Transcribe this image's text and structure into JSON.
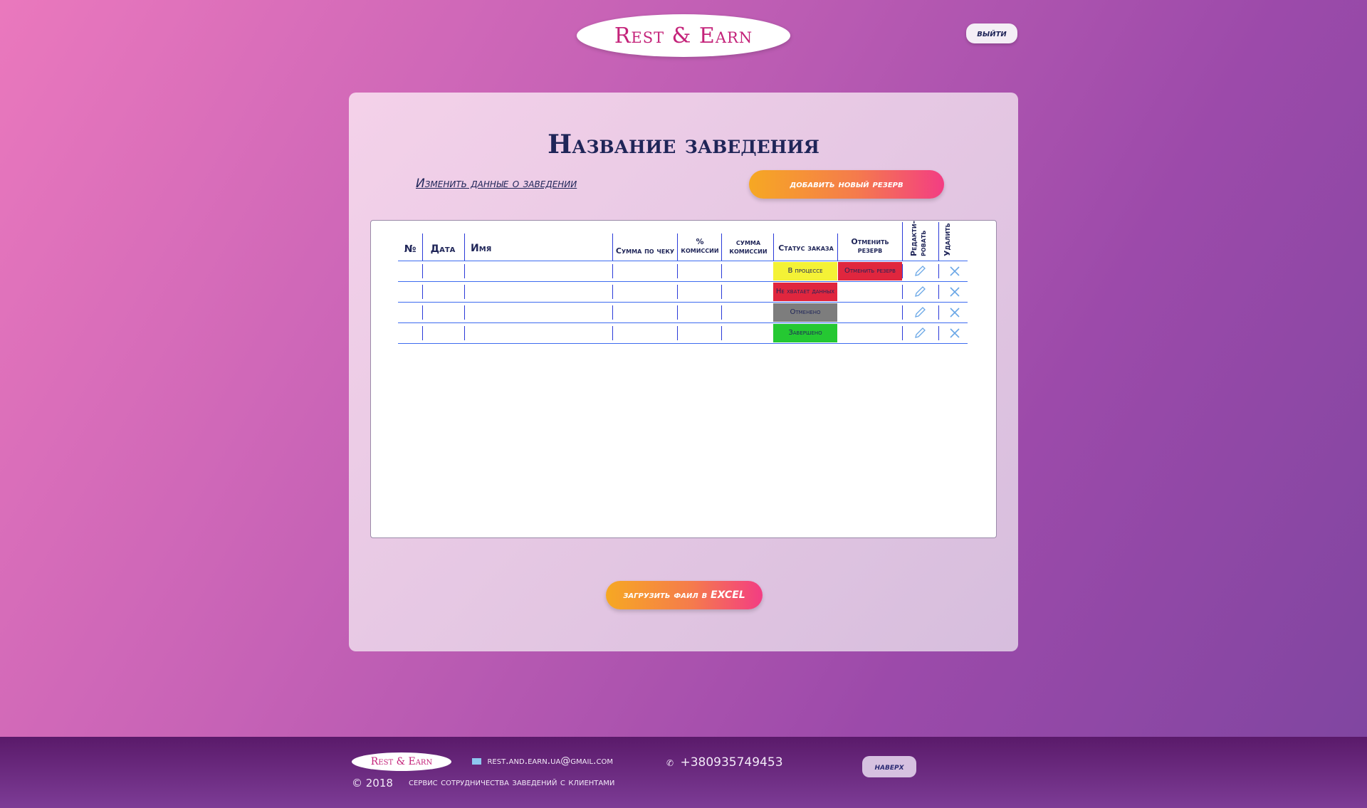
{
  "header": {
    "logo_text": "Rest & Earn",
    "logout_label": "выйти"
  },
  "main": {
    "title": "Название заведения",
    "edit_link": "Изменить данные о заведении",
    "add_button": "добавить новый резерв",
    "excel_button": "загрузить фаил в EXCEL"
  },
  "table": {
    "headers": {
      "num": "№",
      "date": "Дата",
      "name": "Имя",
      "check_sum": "Сумма по чеку",
      "commission_pct_1": "%",
      "commission_pct_2": "комиссии",
      "commission_sum_1": "сумма",
      "commission_sum_2": "комиссии",
      "status": "Статус заказа",
      "cancel_1": "Отменить",
      "cancel_2": "резерв",
      "edit": "Редакти-ровать",
      "delete": "Удалить"
    },
    "rows": [
      {
        "status": "В процессе",
        "status_color": "#f4f236",
        "cancel": "Отменить резерв"
      },
      {
        "status": "Не хватает данных",
        "status_color": "#e0263e",
        "cancel": ""
      },
      {
        "status": "Отменено",
        "status_color": "#7d7d7d",
        "cancel": ""
      },
      {
        "status": "Завершено",
        "status_color": "#25c832",
        "cancel": ""
      }
    ]
  },
  "footer": {
    "logo_text": "Rest & Earn",
    "email": "rest.and.earn.ua@gmail.com",
    "phone": "+380935749453",
    "copyright": "© 2018",
    "tagline": "сервис сотрудничества заведений с клиентами",
    "top_button": "наверх"
  },
  "colors": {
    "accent_gradient_start": "#f6a823",
    "accent_gradient_end": "#f33d83",
    "text_dark": "#1f2558",
    "grid_line": "#3d6bf0"
  }
}
